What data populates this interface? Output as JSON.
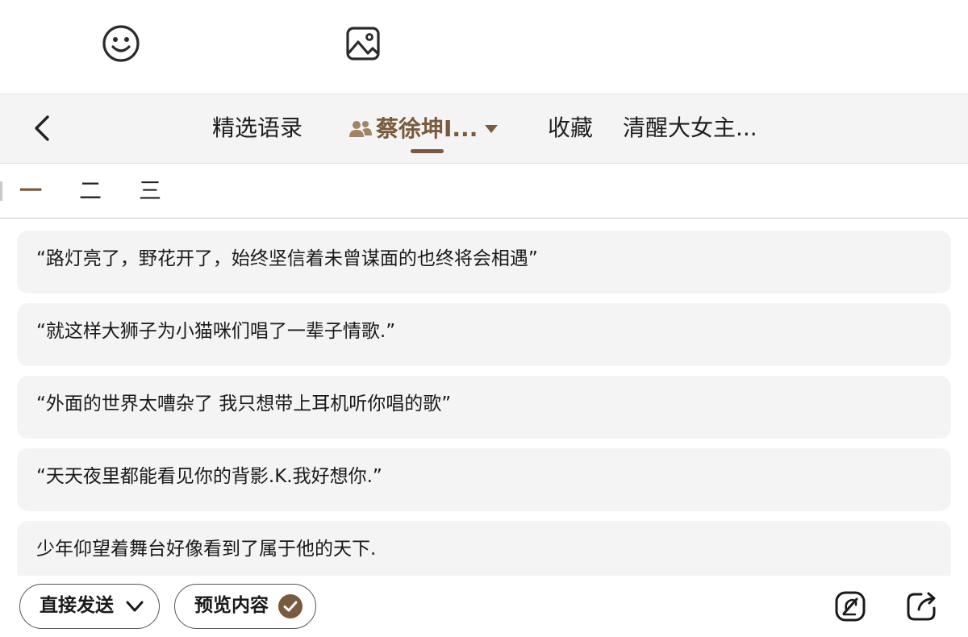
{
  "toolbar": {
    "emoji_icon": "smiley-icon",
    "image_icon": "image-icon"
  },
  "nav": {
    "back_icon": "chevron-left-icon",
    "tabs": [
      {
        "label": "精选语录"
      },
      {
        "label": "蔡徐坤I...",
        "icon": "person-group-icon",
        "active": true
      },
      {
        "label": "收藏"
      },
      {
        "label": "清醒大女主..."
      }
    ]
  },
  "subtabs": [
    "一",
    "二",
    "三"
  ],
  "quotes": [
    "“路灯亮了，野花开了，始终坚信着未曾谋面的也终将会相遇”",
    "“就这样大狮子为小猫咪们唱了一辈子情歌.”",
    "“外面的世界太嘈杂了 我只想带上耳机听你唱的歌”",
    "“天天夜里都能看见你的背影.K.我好想你.”",
    "少年仰望着舞台好像看到了属于他的天下."
  ],
  "bottom": {
    "send_label": "直接发送",
    "preview_label": "预览内容",
    "edit_icon": "edit-icon",
    "share_icon": "share-icon"
  },
  "colors": {
    "accent": "#7a5a3c",
    "card_bg": "#f4f4f4",
    "nav_bg": "#f4f4f4"
  }
}
